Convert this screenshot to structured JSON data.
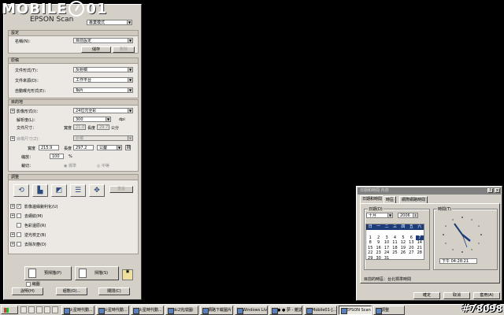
{
  "watermark": {
    "brand_left": "MOBILE",
    "brand_right": "01",
    "image_id": "#78098"
  },
  "epson": {
    "title": "EPSON Scan",
    "mode": "專業模式",
    "settings": {
      "header": "設定",
      "name_label": "名稱(N)：",
      "name_value": "目前設定",
      "save_label": "儲存",
      "delete_label": "刪除"
    },
    "original": {
      "header": "原稿",
      "doc_type_label": "文件形式(T)：",
      "doc_type_value": "反射稿",
      "doc_source_label": "文件來源(D)：",
      "doc_source_value": "工作平台",
      "auto_exposure_label": "自動曝光形式(E)：",
      "auto_exposure_value": "相片"
    },
    "destination": {
      "header": "目的地",
      "image_type_label": "影像形式(I)：",
      "image_type_value": "24位元全彩",
      "resolution_label": "解析度(L)：",
      "resolution_value": "300",
      "resolution_unit": "dpi",
      "doc_size_label": "文件尺寸：",
      "width_label": "寬度",
      "width_value": "21.0",
      "height_label": "長度",
      "height_value": "29.7",
      "size_unit": "公分",
      "target_size_label": "目標尺寸(Z)：",
      "target_size_value": "原稿",
      "width2_label": "寬度",
      "width2_value": "215.9",
      "height2_label": "長度",
      "height2_value": "297.2",
      "unit2_value": "公釐",
      "scale_label": "縮放：",
      "scale_value": "100",
      "scale_unit": "%",
      "trim_label": "裁切：",
      "trim_opt1": "標準",
      "trim_opt2": "中等"
    },
    "adjustments": {
      "header": "調整",
      "reset_label": "重設",
      "items": [
        {
          "label": "影像邊緣銳利化(U)",
          "checked": true
        },
        {
          "label": "去網紋(M)",
          "checked": false
        },
        {
          "label": "色彩還原(R)",
          "checked": false
        },
        {
          "label": "逆光校正(B)",
          "checked": false
        },
        {
          "label": "去除灰塵(D)",
          "checked": false
        }
      ]
    },
    "preview_label": "預掃描(P)",
    "scan_label": "掃描(S)",
    "thumb_label": "縮圖",
    "help_label": "說明(H)",
    "config_label": "組態(O)...",
    "close_label": "關閉(C)"
  },
  "datetime": {
    "title": "日期和時間 內容",
    "tabs": [
      "日期和時間",
      "時區",
      "網際網路時間"
    ],
    "date_group": "日期(D)",
    "month": "十月",
    "year": "2006",
    "weekdays": [
      "日",
      "一",
      "二",
      "三",
      "四",
      "五",
      "六"
    ],
    "days": [
      "",
      "",
      "",
      "",
      "",
      "",
      "",
      "1",
      "2",
      "3",
      "4",
      "5",
      "6",
      "7",
      "8",
      "9",
      "10",
      "11",
      "12",
      "13",
      "14",
      "15",
      "16",
      "17",
      "18",
      "19",
      "20",
      "21",
      "22",
      "23",
      "24",
      "25",
      "26",
      "27",
      "28",
      "29",
      "30",
      "31"
    ],
    "selected_day": "7",
    "time_group": "時間(T)",
    "time_value": "下午 04:28:21",
    "timezone_text": "目前的時區：台北標準時間",
    "ok_label": "確定",
    "cancel_label": "取消",
    "apply_label": "套用(A)"
  },
  "taskbar": {
    "tasks": [
      "火星時代動...",
      "火星時代動...",
      "火星時代動...",
      "dc2完成圖i",
      "網路下載圖片",
      "Windows Liv...",
      "● ● 夢 - 雜誌",
      "Mobile01-[...",
      "EPSON Scan",
      "調整"
    ]
  }
}
